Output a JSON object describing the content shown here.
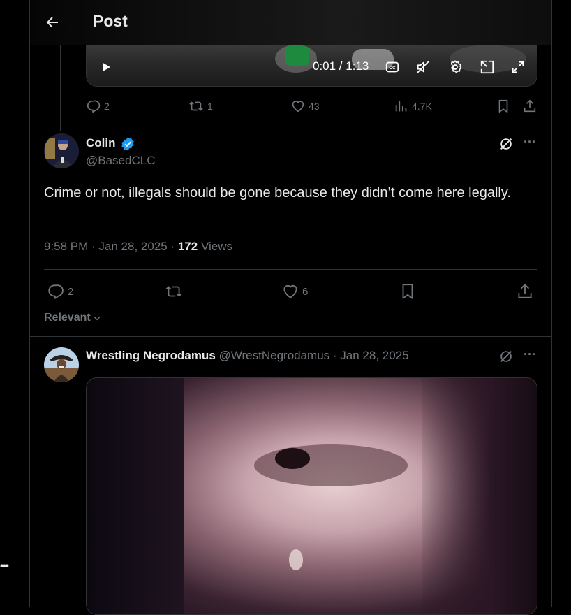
{
  "header": {
    "title": "Post"
  },
  "video": {
    "time": "0:01 / 1:13"
  },
  "parent_actions": {
    "replies": "2",
    "reposts": "1",
    "likes": "43",
    "views": "4.7K"
  },
  "main_post": {
    "name": "Colin",
    "handle": "@BasedCLC",
    "text": "Crime or not, illegals should be gone because they didn’t come here legally.",
    "time": "9:58 PM · Jan 28, 2025 · ",
    "views_count": "172",
    "views_label": " Views",
    "actions": {
      "replies": "2",
      "likes": "6"
    }
  },
  "sort": {
    "label": "Relevant"
  },
  "reply": {
    "name": "Wrestling Negrodamus",
    "handle": "@WrestNegrodamus",
    "date": " · Jan 28, 2025"
  },
  "colors": {
    "verified": "#1d9bf0",
    "muted": "#71767b",
    "text": "#e7e9ea",
    "border": "#2f3336"
  },
  "icons": [
    "back-arrow-icon",
    "play-icon",
    "captions-icon",
    "mute-icon",
    "settings-icon",
    "pip-icon",
    "fullscreen-icon",
    "reply-icon",
    "repost-icon",
    "like-icon",
    "views-icon",
    "bookmark-icon",
    "share-icon",
    "verified-icon",
    "grok-icon",
    "more-icon",
    "chevron-down-icon"
  ]
}
